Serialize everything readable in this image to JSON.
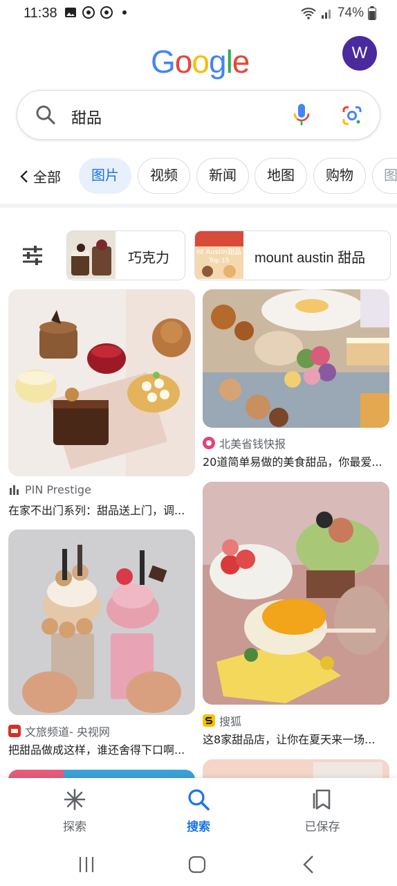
{
  "status_bar": {
    "time": "11:38",
    "battery": "74%"
  },
  "header": {
    "logo": [
      "G",
      "o",
      "o",
      "g",
      "l",
      "e"
    ],
    "logo_colors": [
      "#4285F4",
      "#EA4335",
      "#FBBC05",
      "#4285F4",
      "#34A853",
      "#EA4335"
    ],
    "avatar_letter": "W"
  },
  "search": {
    "query": "甜品"
  },
  "tabs": {
    "back_label": "全部",
    "items": [
      "图片",
      "视频",
      "新闻",
      "地图",
      "购物",
      "图"
    ],
    "active_index": 0
  },
  "suggestions": [
    {
      "label": "巧克力"
    },
    {
      "label": "mount austin 甜品",
      "thumb_text": "nt Austin甜品",
      "thumb_sub": "Top 15"
    }
  ],
  "results": [
    {
      "source": "PIN Prestige",
      "caption": "在家不出门系列：甜品送上门，调..."
    },
    {
      "source": "北美省钱快报",
      "caption": "20道简单易做的美食甜品，你最爱..."
    },
    {
      "source": "文旅频道- 央视网",
      "caption": "把甜品做成这样，谁还舍得下口啊..."
    },
    {
      "source": "搜狐",
      "caption": "这8家甜品店，让你在夏天来一场..."
    }
  ],
  "bottom_nav": {
    "items": [
      "探索",
      "搜索",
      "已保存"
    ],
    "active_index": 1
  },
  "colors": {
    "accent": "#1a73e8",
    "avatar_bg": "#4a2a9c",
    "chip_active_bg": "#e8f0fe"
  }
}
